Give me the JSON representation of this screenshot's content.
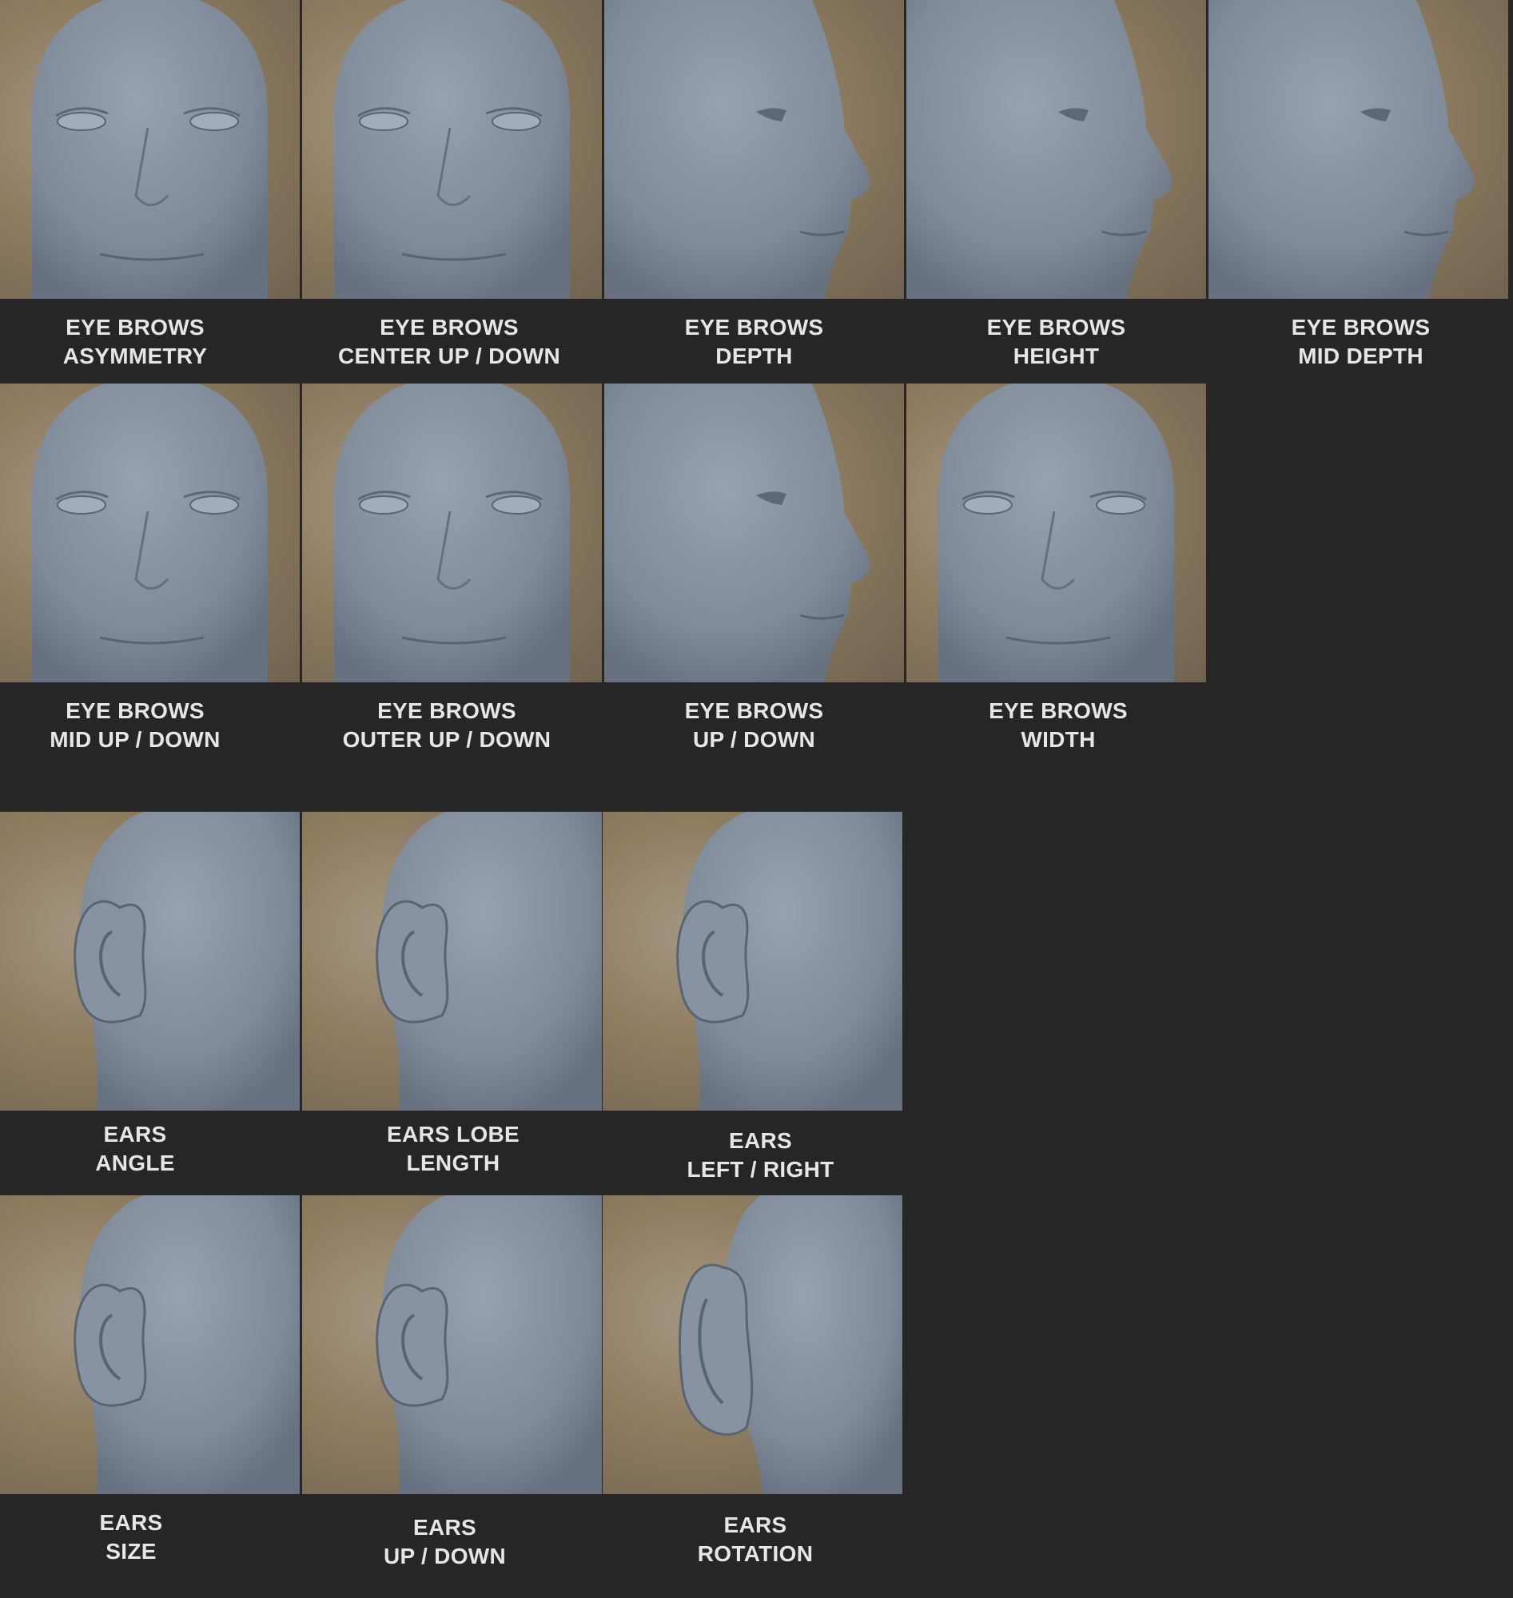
{
  "eyebrows": [
    {
      "line1": "EYE BROWS",
      "line2": "ASYMMETRY",
      "view": "front-face"
    },
    {
      "line1": "EYE BROWS",
      "line2": "CENTER UP / DOWN",
      "view": "front-face"
    },
    {
      "line1": "EYE BROWS",
      "line2": "DEPTH",
      "view": "side-face"
    },
    {
      "line1": "EYE BROWS",
      "line2": "HEIGHT",
      "view": "side-face"
    },
    {
      "line1": "EYE BROWS",
      "line2": "MID DEPTH",
      "view": "side-face"
    },
    {
      "line1": "EYE BROWS",
      "line2": "MID UP / DOWN",
      "view": "front-face"
    },
    {
      "line1": "EYE BROWS",
      "line2": "OUTER UP / DOWN",
      "view": "front-face"
    },
    {
      "line1": "EYE BROWS",
      "line2": "UP / DOWN",
      "view": "side-face"
    },
    {
      "line1": "EYE BROWS",
      "line2": "WIDTH",
      "view": "front-face"
    }
  ],
  "ears": [
    {
      "line1": "EARS",
      "line2": "ANGLE",
      "view": "ear"
    },
    {
      "line1": "EARS LOBE",
      "line2": "LENGTH",
      "view": "ear"
    },
    {
      "line1": "EARS",
      "line2": "LEFT / RIGHT",
      "view": "ear"
    },
    {
      "line1": "EARS",
      "line2": "SIZE",
      "view": "ear"
    },
    {
      "line1": "EARS",
      "line2": "UP / DOWN",
      "view": "ear"
    },
    {
      "line1": "EARS",
      "line2": "ROTATION",
      "view": "ear-angled"
    }
  ],
  "colors": {
    "background": "#262626",
    "skin": "#7f8a99",
    "label": "#e6e6e6"
  }
}
